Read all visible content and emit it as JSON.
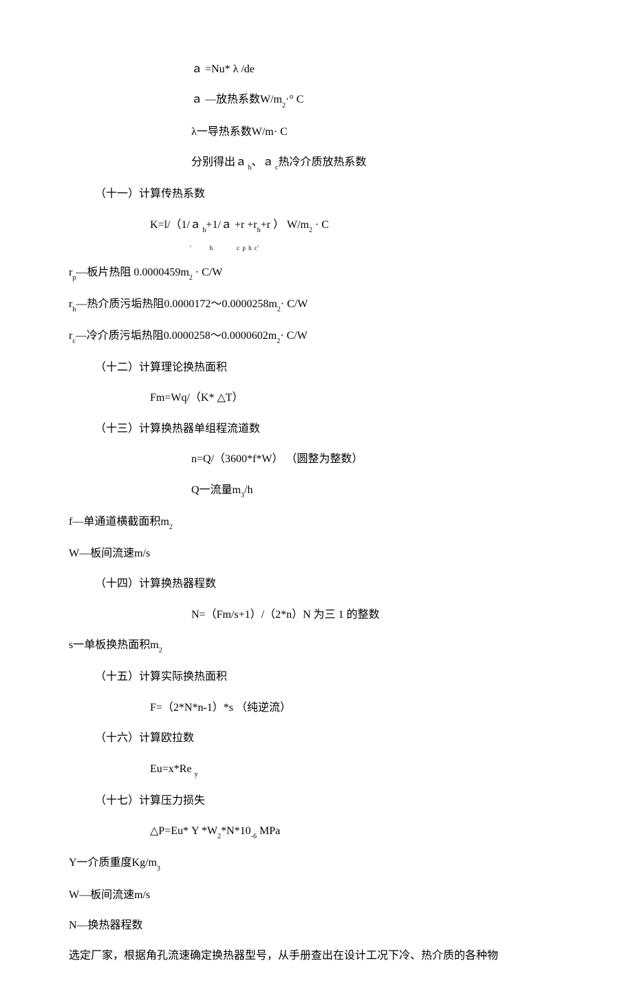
{
  "lines": [
    {
      "cls": "indent3",
      "html": "ａ =Nu* λ  /de"
    },
    {
      "cls": "indent3",
      "html": "ａ —放热系数W/m<span class='sub'>2</span>·° C"
    },
    {
      "cls": "indent3",
      "html": "λ一导热系数W/m· C"
    },
    {
      "cls": "indent3",
      "html": "分别得出ａ<span class='sub'> h</span>、ａ<span class='sub'> c</span>热冷介质放热系数"
    },
    {
      "cls": "indent1",
      "html": "（十一）计算传热系数"
    },
    {
      "cls": "indent2",
      "html": "K=l/（1/ａ<span class='sub'> h</span>+1/ａ +r +r<span class='sub'>h</span>+r ） W/m<span class='sub'>2</span> · C<br><span style='display:inline-block;width:58px;'></span><span class='smallsub'>'</span><span style='display:inline-block;width:26px;'></span><span class='smallsub'>h</span><span style='display:inline-block;width:34px;'></span><span class='smallsub'>c p h c'</span>"
    },
    {
      "cls": "",
      "html": "r<span class='sub'>p</span>—板片热阻  0.0000459m<span class='sub'>2</span> ·  C/W"
    },
    {
      "cls": "",
      "html": "r<span class='sub'>h</span>—热介质污垢热阻0.0000172〜0.0000258m<span class='sub'>2</span>· C/W"
    },
    {
      "cls": "",
      "html": "r<span class='sub'>c</span>—冷介质污垢热阻0.0000258〜0.0000602m<span class='sub'>2</span>· C/W"
    },
    {
      "cls": "indent1",
      "html": "（十二）计算理论换热面积"
    },
    {
      "cls": "indent2",
      "html": "Fm=Wq/（K* △T）"
    },
    {
      "cls": "indent1",
      "html": "（十三）计算换热器单组程流道数"
    },
    {
      "cls": "indent3",
      "html": "n=Q/（3600*f*W） （圆整为整数）"
    },
    {
      "cls": "indent3",
      "html": "Q一流量m<span class='sub'>3</span>/h"
    },
    {
      "cls": "",
      "html": "f—单通道横截面积m<span class='sub'>2</span>"
    },
    {
      "cls": "",
      "html": "W—板间流速m/s"
    },
    {
      "cls": "indent1",
      "html": "（十四）计算换热器程数"
    },
    {
      "cls": "indent3",
      "html": "N=（Fm/s+1）/（2*n）N 为三  1 的整数"
    },
    {
      "cls": "",
      "html": "s一单板换热面积m<span class='sub'>2</span>"
    },
    {
      "cls": "indent1",
      "html": "（十五）计算实际换热面积"
    },
    {
      "cls": "indent2",
      "html": "F=（2*N*n-1）*s （纯逆流）"
    },
    {
      "cls": "indent1",
      "html": "（十六）计算欧拉数"
    },
    {
      "cls": "indent2",
      "html": "Eu=x*Re <span class='sub'>y</span>"
    },
    {
      "cls": "indent1",
      "html": "（十七）计算压力损失"
    },
    {
      "cls": "indent2",
      "html": "△P=Eu* Υ *W<span class='sub'>2</span>*N*10<span class='sub'>-6</span> MPa"
    },
    {
      "cls": "",
      "html": "Υ一介质重度Kg/m<span class='sub'>3</span>"
    },
    {
      "cls": "",
      "html": "W—板间流速m/s"
    },
    {
      "cls": "",
      "html": "N—换热器程数"
    },
    {
      "cls": "",
      "html": "选定厂家，根据角孔流速确定换热器型号，从手册查出在设计工况下冷、热介质的各种物"
    }
  ]
}
